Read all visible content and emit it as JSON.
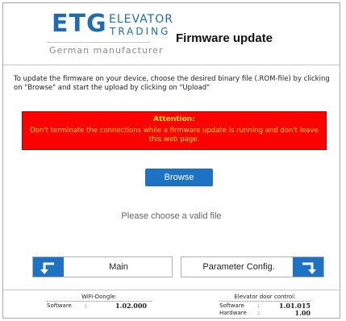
{
  "header": {
    "logo": {
      "etg": "ETG",
      "elevator": "ELEVATOR",
      "trading": "TRADING",
      "tagline": "German manufacturer"
    },
    "title": "Firmware update"
  },
  "instructions": "To update the firmware on your device, choose the desired binary file (.ROM-file) by clicking on \"Browse\" and start the upload by clicking on \"Upload\"",
  "attention": {
    "title": "Attention:",
    "text": "Don't terminate the connections while a firmware update is running and don't leave this web page."
  },
  "browse_label": "Browse",
  "status_message": "Please choose a valid file",
  "nav": {
    "main_label": "Main",
    "param_label": "Parameter Config.",
    "icons": [
      "return-arrow-icon",
      "forward-arrow-icon"
    ]
  },
  "footer": {
    "wifi": {
      "title": "WiFi-Dongle:",
      "software_label": "Software",
      "colon": ":",
      "software_value": "1.02.000"
    },
    "door": {
      "title": "Elevator door control:",
      "software_label": "Software",
      "software_value": "1.01.015",
      "colon": ":",
      "hardware_label": "Hardware",
      "hardware_value": "1.00"
    }
  },
  "colors": {
    "brand_blue": "#1d72c4",
    "attention_bg": "#ff0000",
    "attention_text": "#ffdd00"
  }
}
